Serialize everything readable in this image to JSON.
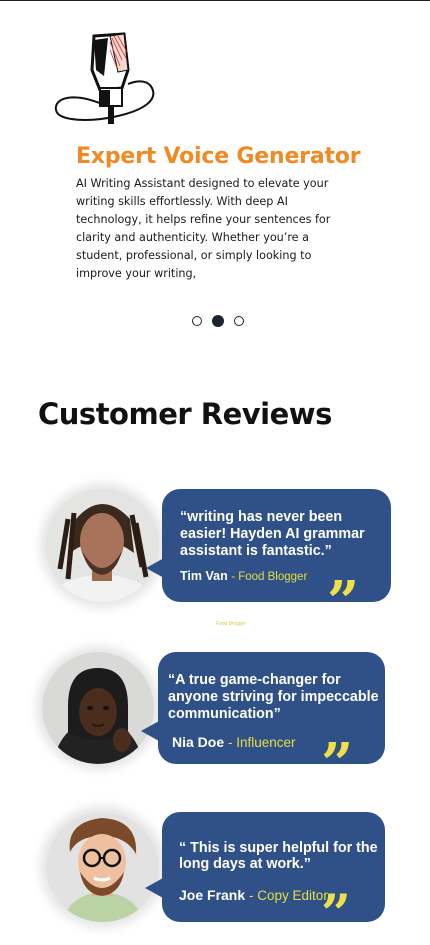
{
  "slide": {
    "title": "Expert Voice Generator",
    "body": "AI Writing Assistant designed to elevate your writing skills effortlessly. With deep AI technology, it helps refine your sentences for clarity and authenticity. Whether you’re a student, professional, or simply looking to improve your writing,",
    "active_index": 1,
    "count": 3
  },
  "reviews": {
    "heading": "Customer Reviews",
    "caption": "Food Blogger",
    "items": [
      {
        "quote": "“writing has never been easier! Hayden AI grammar assistant  is fantastic.”",
        "name": "Tim Van",
        "role": "- Food Blogger"
      },
      {
        "quote": "“A true game-changer for anyone striving for  impeccable communication”",
        "name": "Nia Doe",
        "role": " - Influencer"
      },
      {
        "quote": "“ This is super helpful for the long days at work.”",
        "name": "Joe Frank",
        "role": " - Copy Editor"
      }
    ]
  },
  "colors": {
    "accent_orange": "#F08A24",
    "bubble_blue": "#2F5188",
    "quote_yellow": "#EDE04A"
  },
  "icons": {
    "hero": "microphone-icon",
    "quote": "closing-quote-icon"
  }
}
